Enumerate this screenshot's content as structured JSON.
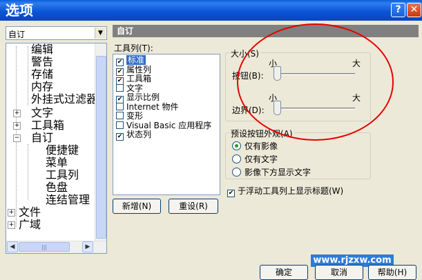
{
  "window": {
    "title": "选项",
    "help_icon": "?",
    "close_icon": "✕"
  },
  "combo": {
    "value": "自订",
    "arrow": "▼"
  },
  "tree": {
    "items": [
      {
        "label": "编辑",
        "expander": ""
      },
      {
        "label": "警告",
        "expander": ""
      },
      {
        "label": "存储",
        "expander": ""
      },
      {
        "label": "内存",
        "expander": ""
      },
      {
        "label": "外挂式过滤器",
        "expander": ""
      },
      {
        "label": "文字",
        "expander": "+"
      },
      {
        "label": "工具箱",
        "expander": "+"
      },
      {
        "label": "自订",
        "expander": "−"
      },
      {
        "label": "便捷键",
        "expander": ""
      },
      {
        "label": "菜单",
        "expander": ""
      },
      {
        "label": "工具列",
        "expander": ""
      },
      {
        "label": "色盘",
        "expander": ""
      },
      {
        "label": "连结管理",
        "expander": ""
      },
      {
        "label": "文件",
        "expander": "+"
      },
      {
        "label": "广域",
        "expander": "+"
      }
    ],
    "scroll_up": "▲",
    "scroll_down": "▼",
    "scroll_left": "◀",
    "scroll_right": "▶",
    "hthumb_grip": "|||"
  },
  "panel": {
    "header": "自订",
    "toolbar_list_label": "工具列(T):",
    "toolbars": [
      {
        "label": "标准",
        "checked": true,
        "selected": true
      },
      {
        "label": "属性列",
        "checked": true
      },
      {
        "label": "工具箱",
        "checked": true
      },
      {
        "label": "文字",
        "checked": false
      },
      {
        "label": "显示比例",
        "checked": true
      },
      {
        "label": "Internet 物件",
        "checked": false
      },
      {
        "label": "变形",
        "checked": false
      },
      {
        "label": "Visual Basic 应用程序",
        "checked": false
      },
      {
        "label": "状态列",
        "checked": true
      }
    ],
    "checkmark": "✔",
    "new_button": "新增(N)",
    "reset_button": "重设(R)",
    "size_group": "大小(S)",
    "small": "小",
    "large": "大",
    "button_label": "按钮(B):",
    "border_label": "边界(D):",
    "button_slider_value": 0,
    "border_slider_value": 0,
    "appearance_group": "预设按钮外观(A)",
    "appearance_options": [
      {
        "label": "仅有影像",
        "selected": true
      },
      {
        "label": "仅有文字",
        "selected": false
      },
      {
        "label": "影像下方显示文字",
        "selected": false
      }
    ],
    "floating_titles_label": "于浮动工具列上显示标题(W)",
    "floating_titles_checked": true
  },
  "footer": {
    "ok": "确定",
    "cancel": "取消",
    "help": "帮助(H)"
  },
  "watermark": "www.rjzxw.com",
  "colors": {
    "annotation_circle": "#e60000",
    "title_bar": "#0c55d6",
    "selection": "#316ac5"
  }
}
